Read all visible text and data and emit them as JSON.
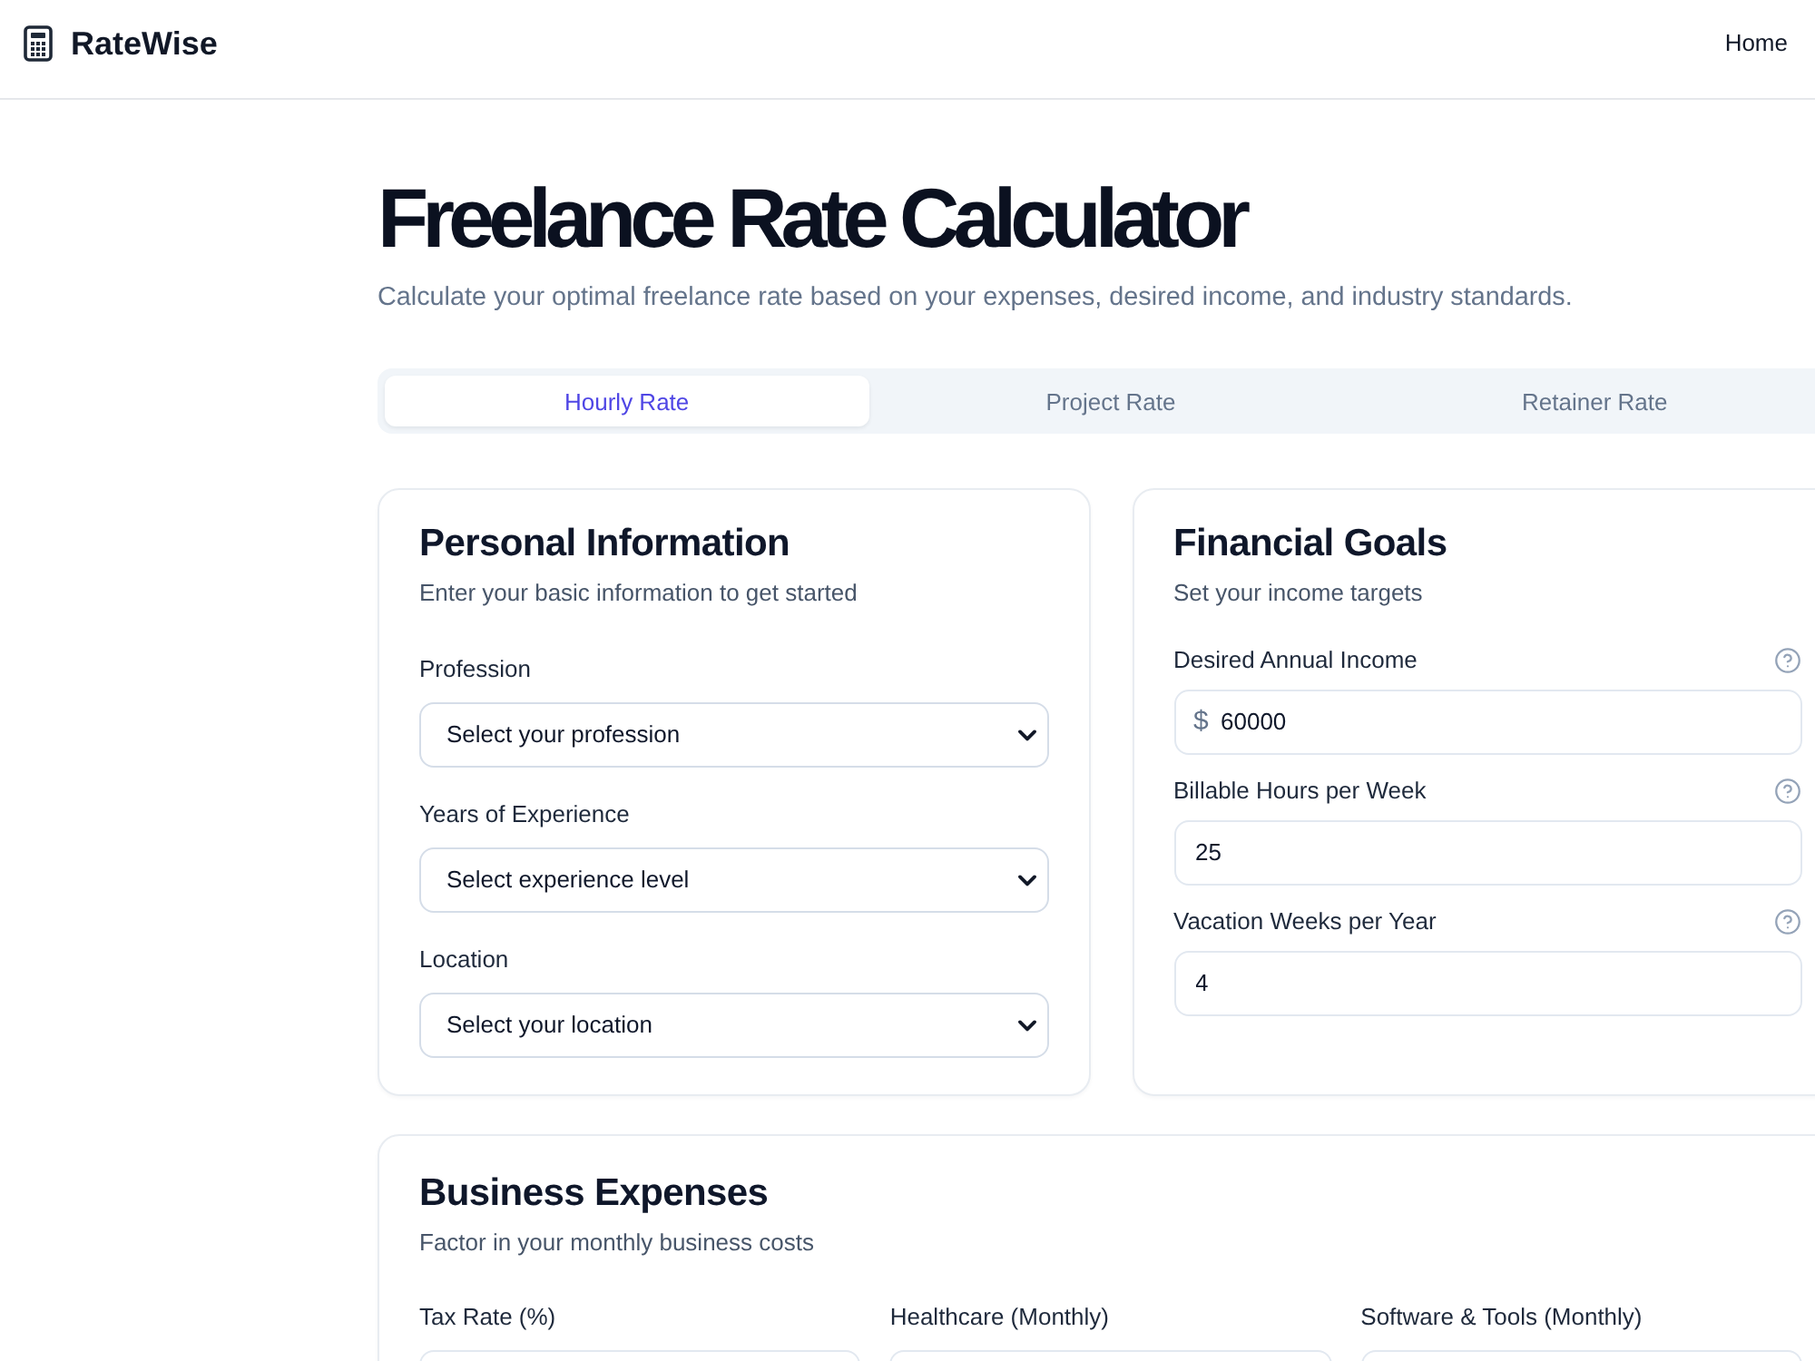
{
  "header": {
    "logo": "RateWise",
    "nav": [
      {
        "label": "Home"
      }
    ]
  },
  "page": {
    "title": "Freelance Rate Calculator",
    "subtitle": "Calculate your optimal freelance rate based on your expenses, desired income, and industry standards."
  },
  "tabs": [
    {
      "label": "Hourly Rate",
      "selected": true
    },
    {
      "label": "Project Rate",
      "selected": false
    },
    {
      "label": "Retainer Rate",
      "selected": false
    }
  ],
  "personal_information": {
    "title": "Personal Information",
    "subtitle": "Enter your basic information to get started",
    "fields": [
      {
        "label": "Profession",
        "placeholder": "Select your profession"
      },
      {
        "label": "Years of Experience",
        "placeholder": "Select experience level"
      },
      {
        "label": "Location",
        "placeholder": "Select your location"
      }
    ]
  },
  "financial_goals": {
    "title": "Financial Goals",
    "subtitle": "Set your income targets",
    "fields": [
      {
        "label": "Desired Annual Income",
        "prefix": "$",
        "value": "60000"
      },
      {
        "label": "Billable Hours per Week",
        "value": "25"
      },
      {
        "label": "Vacation Weeks per Year",
        "value": "4"
      }
    ]
  },
  "business_expenses": {
    "title": "Business Expenses",
    "subtitle": "Factor in your monthly business costs",
    "fields": [
      {
        "label": "Tax Rate (%)"
      },
      {
        "label": "Healthcare (Monthly)"
      },
      {
        "label": "Software & Tools (Monthly)"
      }
    ]
  }
}
